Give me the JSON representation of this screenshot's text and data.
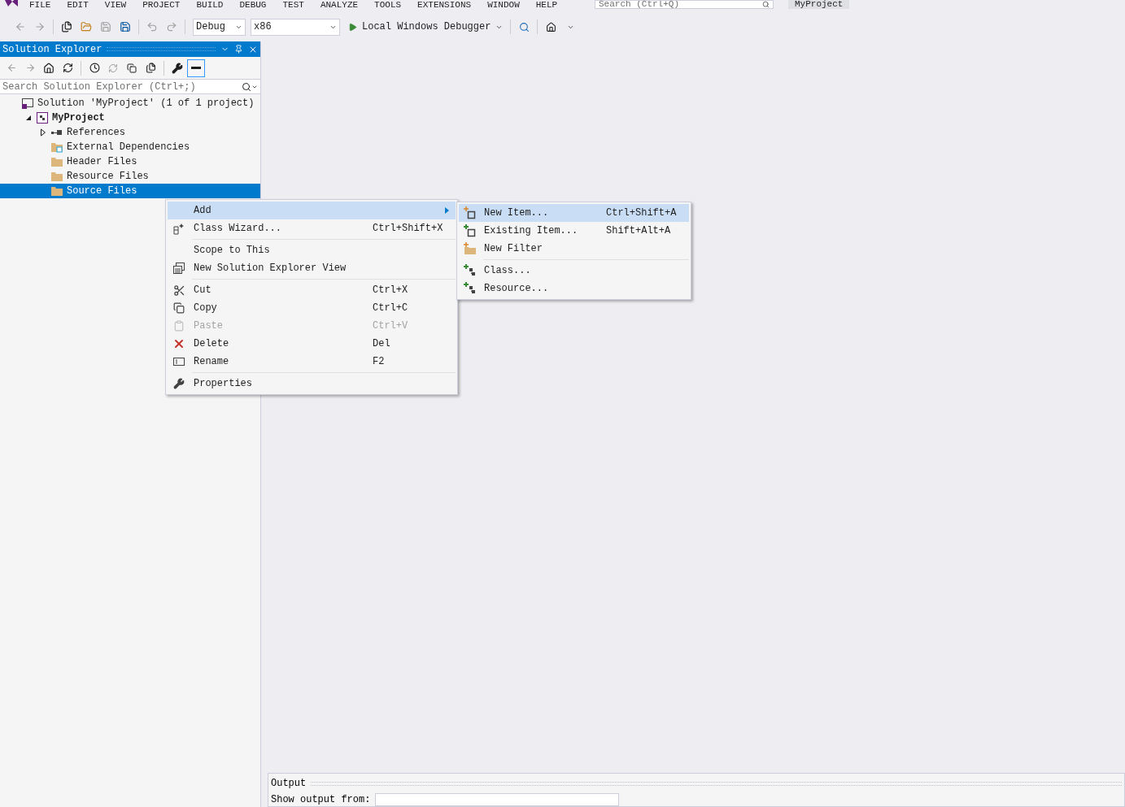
{
  "menu_bar": [
    "FILE",
    "EDIT",
    "VIEW",
    "PROJECT",
    "BUILD",
    "DEBUG",
    "TEST",
    "ANALYZE",
    "TOOLS",
    "EXTENSIONS",
    "WINDOW",
    "HELP"
  ],
  "quick_launch": {
    "placeholder": "Search (Ctrl+Q)"
  },
  "project_title": "MyProject",
  "toolbar": {
    "configuration": "Debug",
    "platform": "x86",
    "debugger": "Local Windows Debugger"
  },
  "solution_explorer": {
    "title": "Solution Explorer",
    "search": {
      "placeholder": "Search Solution Explorer (Ctrl+;)"
    },
    "tree": [
      {
        "label": "Solution 'MyProject' (1 of 1 project)",
        "kind": "solution",
        "selected": false,
        "children": [
          {
            "label": "MyProject",
            "kind": "project",
            "selected": false,
            "expanded": true,
            "children": [
              {
                "label": "References",
                "kind": "references",
                "selected": false,
                "expanded": false
              },
              {
                "label": "External Dependencies",
                "kind": "external",
                "selected": false
              },
              {
                "label": "Header Files",
                "kind": "filter",
                "selected": false
              },
              {
                "label": "Resource Files",
                "kind": "filter",
                "selected": false
              },
              {
                "label": "Source Files",
                "kind": "filter",
                "selected": true
              }
            ]
          }
        ]
      }
    ]
  },
  "context_menu": {
    "groups": [
      [
        {
          "label": "Add",
          "selected": true,
          "disabled": false,
          "submenu": true
        },
        {
          "label": "Class Wizard...",
          "shortcut": "Ctrl+Shift+X",
          "kind": "wizard",
          "selected": false,
          "disabled": false
        }
      ],
      [
        {
          "label": "Scope to This",
          "selected": false,
          "disabled": false
        },
        {
          "label": "New Solution Explorer View",
          "kind": "windows",
          "selected": false,
          "disabled": false
        }
      ],
      [
        {
          "label": "Cut",
          "shortcut": "Ctrl+X",
          "kind": "cut",
          "selected": false,
          "disabled": false
        },
        {
          "label": "Copy",
          "shortcut": "Ctrl+C",
          "kind": "copy",
          "selected": false,
          "disabled": false
        },
        {
          "label": "Paste",
          "shortcut": "Ctrl+V",
          "kind": "paste",
          "selected": false,
          "disabled": true
        },
        {
          "label": "Delete",
          "shortcut": "Del",
          "kind": "delete",
          "selected": false,
          "disabled": false
        },
        {
          "label": "Rename",
          "shortcut": "F2",
          "kind": "rename",
          "selected": false,
          "disabled": false
        }
      ],
      [
        {
          "label": "Properties",
          "kind": "wrench",
          "selected": false,
          "disabled": false
        }
      ]
    ]
  },
  "submenu": {
    "groups": [
      [
        {
          "label": "New Item...",
          "shortcut": "Ctrl+Shift+A",
          "kind": "new-item",
          "selected": true
        },
        {
          "label": "Existing Item...",
          "shortcut": "Shift+Alt+A",
          "kind": "existing-item",
          "selected": false
        },
        {
          "label": "New Filter",
          "kind": "new-folder",
          "selected": false
        }
      ],
      [
        {
          "label": "Class...",
          "kind": "class",
          "selected": false
        },
        {
          "label": "Resource...",
          "kind": "class",
          "selected": false
        }
      ]
    ]
  },
  "output": {
    "title": "Output",
    "show_output_from": "Show output from:"
  }
}
